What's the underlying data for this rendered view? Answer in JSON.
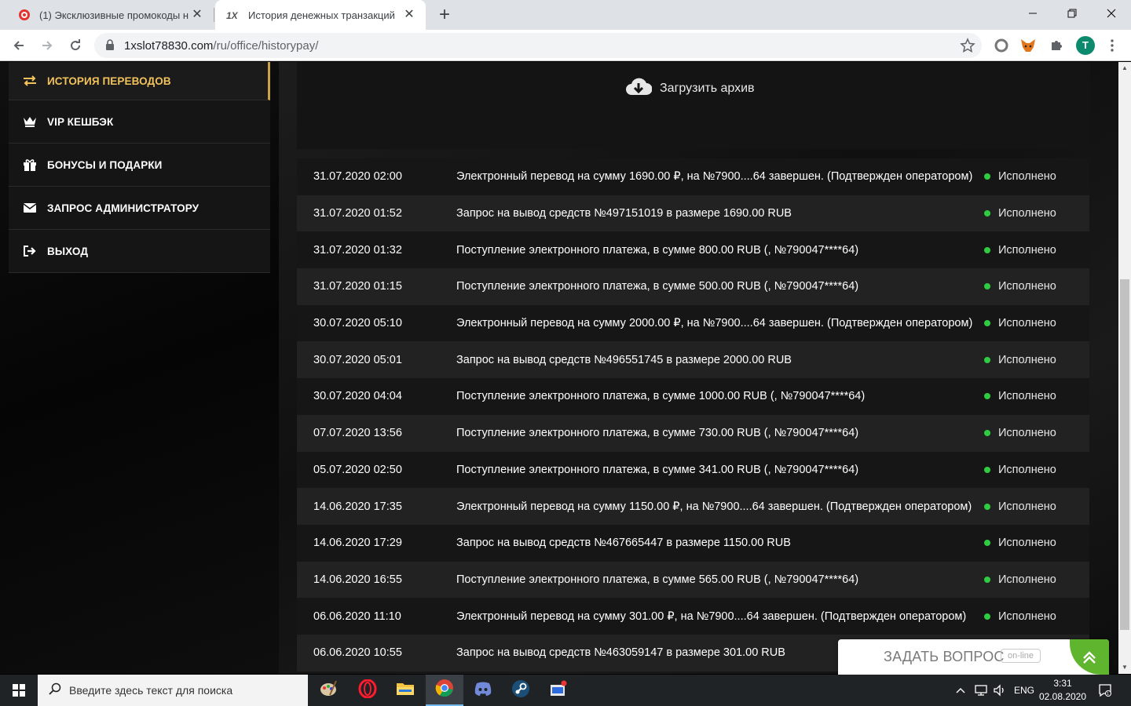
{
  "browser": {
    "tabs": [
      {
        "title": "(1) Эксклюзивные промокоды н",
        "active": false
      },
      {
        "title": "История денежных транзакций",
        "active": true
      }
    ],
    "url_host": "1xslot78830.com",
    "url_path": "/ru/office/historypay/",
    "avatar_letter": "T"
  },
  "sidebar": {
    "items": [
      {
        "label": "ИСТОРИЯ ПЕРЕВОДОВ",
        "icon": "transfer-arrows-icon",
        "active": true
      },
      {
        "label": "VIP КЕШБЭК",
        "icon": "crown-icon",
        "active": false
      },
      {
        "label": "БОНУСЫ И ПОДАРКИ",
        "icon": "gift-icon",
        "active": false
      },
      {
        "label": "ЗАПРОС АДМИНИСТРАТОРУ",
        "icon": "envelope-icon",
        "active": false
      },
      {
        "label": "ВЫХОД",
        "icon": "logout-icon",
        "active": false
      }
    ]
  },
  "main": {
    "archive_label": "Загрузить архив",
    "transactions": [
      {
        "date": "31.07.2020 02:00",
        "desc": "Электронный перевод на сумму 1690.00 ₽, на №7900....64 завершен. (Подтвержден оператором)",
        "status": "Исполнено"
      },
      {
        "date": "31.07.2020 01:52",
        "desc": "Запрос на вывод средств №497151019 в размере 1690.00 RUB",
        "status": "Исполнено"
      },
      {
        "date": "31.07.2020 01:32",
        "desc": "Поступление электронного платежа, в сумме 800.00 RUB (, №790047****64)",
        "status": "Исполнено"
      },
      {
        "date": "31.07.2020 01:15",
        "desc": "Поступление электронного платежа, в сумме 500.00 RUB (, №790047****64)",
        "status": "Исполнено"
      },
      {
        "date": "30.07.2020 05:10",
        "desc": "Электронный перевод на сумму 2000.00 ₽, на №7900....64 завершен. (Подтвержден оператором)",
        "status": "Исполнено"
      },
      {
        "date": "30.07.2020 05:01",
        "desc": "Запрос на вывод средств №496551745 в размере 2000.00 RUB",
        "status": "Исполнено"
      },
      {
        "date": "30.07.2020 04:04",
        "desc": "Поступление электронного платежа, в сумме 1000.00 RUB (, №790047****64)",
        "status": "Исполнено"
      },
      {
        "date": "07.07.2020 13:56",
        "desc": "Поступление электронного платежа, в сумме 730.00 RUB (, №790047****64)",
        "status": "Исполнено"
      },
      {
        "date": "05.07.2020 02:50",
        "desc": "Поступление электронного платежа, в сумме 341.00 RUB (, №790047****64)",
        "status": "Исполнено"
      },
      {
        "date": "14.06.2020 17:35",
        "desc": "Электронный перевод на сумму 1150.00 ₽, на №7900....64 завершен. (Подтвержден оператором)",
        "status": "Исполнено"
      },
      {
        "date": "14.06.2020 17:29",
        "desc": "Запрос на вывод средств №467665447 в размере 1150.00 RUB",
        "status": "Исполнено"
      },
      {
        "date": "14.06.2020 16:55",
        "desc": "Поступление электронного платежа, в сумме 565.00 RUB (, №790047****64)",
        "status": "Исполнено"
      },
      {
        "date": "06.06.2020 11:10",
        "desc": "Электронный перевод на сумму 301.00 ₽, на №7900....64 завершен. (Подтвержден оператором)",
        "status": "Исполнено"
      },
      {
        "date": "06.06.2020 10:55",
        "desc": "Запрос на вывод средств №463059147 в размере 301.00 RUB",
        "status": ""
      }
    ]
  },
  "chat": {
    "label": "ЗАДАТЬ ВОПРОС",
    "badge": "on-line"
  },
  "taskbar": {
    "search_placeholder": "Введите здесь текст для поиска",
    "language": "ENG",
    "time": "3:31",
    "date": "02.08.2020"
  },
  "colors": {
    "accent_gold": "#f2c35a",
    "status_green": "#2ecc40",
    "chat_green": "#5fb52d"
  }
}
